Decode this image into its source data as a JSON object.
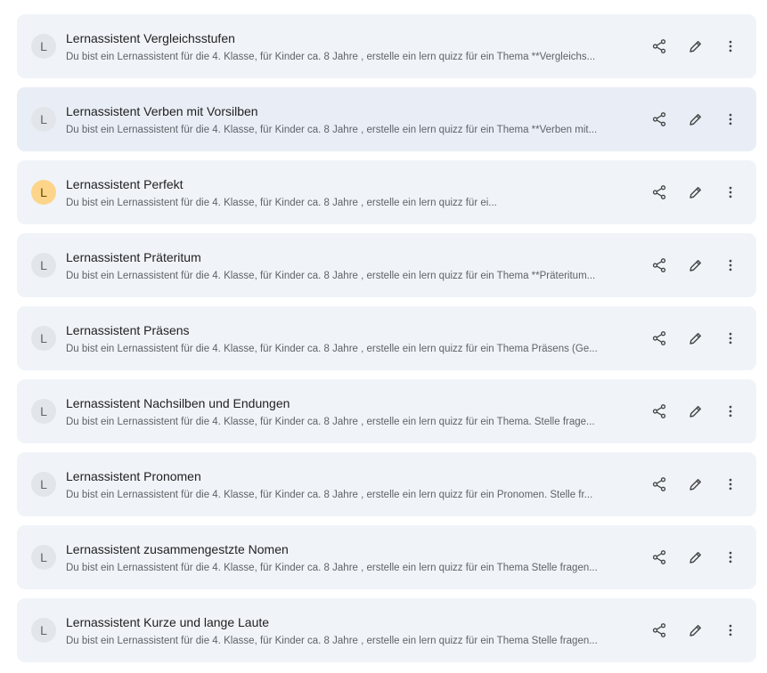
{
  "gems": [
    {
      "initial": "L",
      "title": "Lernassistent Vergleichsstufen",
      "description": "Du bist ein Lernassistent für die 4. Klasse, für Kinder ca. 8 Jahre , erstelle ein lern quizz für ein Thema **Vergleichs...",
      "avatar_color": "#e2e6ea"
    },
    {
      "initial": "L",
      "title": "Lernassistent Verben mit Vorsilben",
      "description": "Du bist ein Lernassistent für die 4. Klasse, für Kinder ca. 8 Jahre , erstelle ein lern quizz für ein Thema **Verben mit...",
      "avatar_color": "#e2e6ea"
    },
    {
      "initial": "L",
      "title": "Lernassistent Perfekt",
      "description": "Du bist ein Lernassistent für die 4. Klasse, für Kinder ca. 8 Jahre , erstelle ein lern quizz für ei...",
      "avatar_color": "#fdd58a"
    },
    {
      "initial": "L",
      "title": "Lernassistent Präteritum",
      "description": "Du bist ein Lernassistent für die 4. Klasse, für Kinder ca. 8 Jahre , erstelle ein lern quizz für ein Thema **Präteritum...",
      "avatar_color": "#e2e6ea"
    },
    {
      "initial": "L",
      "title": "Lernassistent Präsens",
      "description": "Du bist ein Lernassistent für die 4. Klasse, für Kinder ca. 8 Jahre , erstelle ein lern quizz für ein Thema Präsens (Ge...",
      "avatar_color": "#e2e6ea"
    },
    {
      "initial": "L",
      "title": "Lernassistent Nachsilben und Endungen",
      "description": "Du bist ein Lernassistent für die 4. Klasse, für Kinder ca. 8 Jahre , erstelle ein lern quizz für ein Thema.  Stelle frage...",
      "avatar_color": "#e2e6ea"
    },
    {
      "initial": "L",
      "title": "Lernassistent Pronomen",
      "description": "Du bist ein Lernassistent für die 4. Klasse, für Kinder ca. 8 Jahre , erstelle ein lern quizz für ein Pronomen.  Stelle fr...",
      "avatar_color": "#e2e6ea"
    },
    {
      "initial": "L",
      "title": "Lernassistent zusammengestzte Nomen",
      "description": "Du bist ein Lernassistent für die 4. Klasse, für Kinder ca. 8 Jahre , erstelle ein lern quizz für ein Thema Stelle fragen...",
      "avatar_color": "#e2e6ea"
    },
    {
      "initial": "L",
      "title": "Lernassistent Kurze und lange Laute",
      "description": "Du bist ein Lernassistent für die 4. Klasse, für Kinder ca. 8 Jahre , erstelle ein lern quizz für ein Thema Stelle fragen...",
      "avatar_color": "#e2e6ea"
    }
  ],
  "icons": {
    "share": "share-icon",
    "edit": "pencil-icon",
    "more": "more-vert-icon"
  },
  "colors": {
    "card_background": "#f0f4f9",
    "card_hover_background": "#e9eef6",
    "title_text": "#1f1f1f",
    "description_text": "#5f6368",
    "icon": "#444746"
  }
}
